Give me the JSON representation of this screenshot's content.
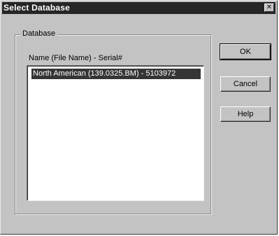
{
  "window": {
    "title": "Select Database",
    "close_glyph": "✕"
  },
  "database_group": {
    "label": "Database",
    "column_header": "Name (File Name) - Serial#",
    "items": [
      {
        "label": "North American (139.0325.BM) - 5103972",
        "selected": true
      }
    ]
  },
  "buttons": {
    "ok": "OK",
    "cancel": "Cancel",
    "help": "Help"
  }
}
